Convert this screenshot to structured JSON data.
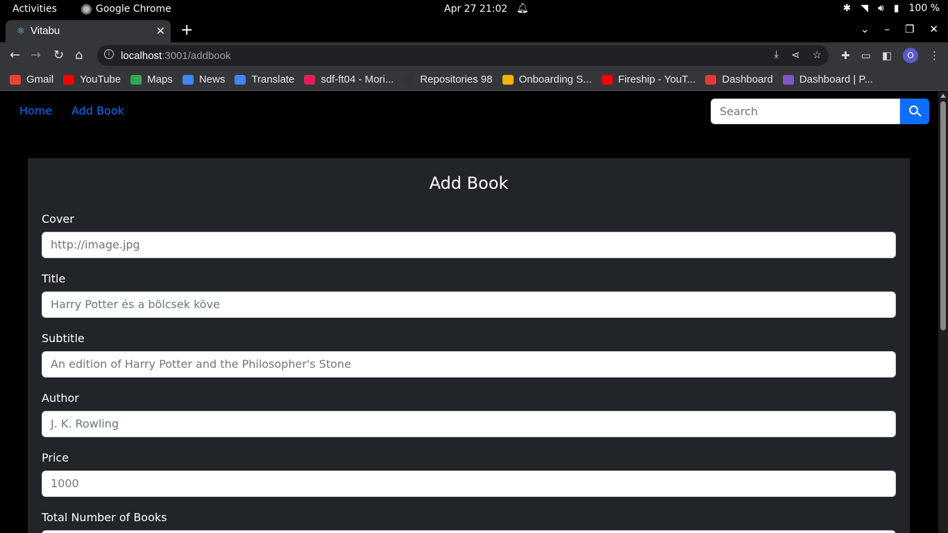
{
  "system": {
    "activities": "Activities",
    "app_name": "Google Chrome",
    "clock": "Apr 27  21:02",
    "battery": "100 %"
  },
  "browser": {
    "tab_title": "Vitabu",
    "url_host": "localhost",
    "url_path": ":3001/addbook",
    "profile_initial": "O",
    "bookmarks": [
      {
        "label": "Gmail",
        "color": "#ea4335"
      },
      {
        "label": "YouTube",
        "color": "#ff0000"
      },
      {
        "label": "Maps",
        "color": "#34a853"
      },
      {
        "label": "News",
        "color": "#4285f4"
      },
      {
        "label": "Translate",
        "color": "#4285f4"
      },
      {
        "label": "sdf-ft04 - Mori...",
        "color": "#e01e5a"
      },
      {
        "label": "Repositories 98",
        "color": "#333333"
      },
      {
        "label": "Onboarding S...",
        "color": "#f4b400"
      },
      {
        "label": "Fireship - YouT...",
        "color": "#ff0000"
      },
      {
        "label": "Dashboard",
        "color": "#e53935"
      },
      {
        "label": "Dashboard | P...",
        "color": "#7e57c2"
      }
    ]
  },
  "app": {
    "nav": {
      "home": "Home",
      "add_book": "Add Book"
    },
    "search_placeholder": "Search",
    "accent": "#0d6efd",
    "form": {
      "title": "Add Book",
      "fields": [
        {
          "label": "Cover",
          "placeholder": "http://image.jpg"
        },
        {
          "label": "Title",
          "placeholder": "Harry Potter és a bölcsek köve"
        },
        {
          "label": "Subtitle",
          "placeholder": "An edition of Harry Potter and the Philosopher's Stone"
        },
        {
          "label": "Author",
          "placeholder": "J. K. Rowling"
        },
        {
          "label": "Price",
          "placeholder": "1000"
        },
        {
          "label": "Total Number of Books",
          "placeholder": ""
        }
      ]
    }
  }
}
